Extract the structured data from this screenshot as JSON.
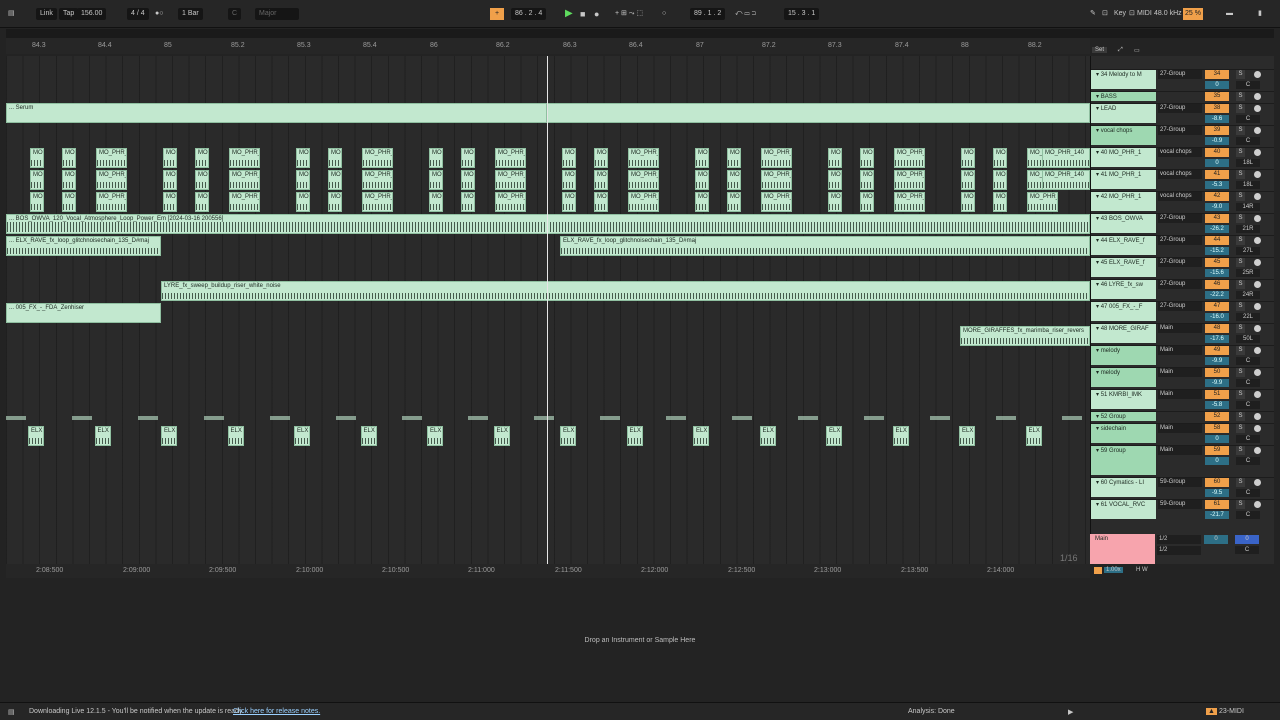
{
  "transport": {
    "link": "Link",
    "tap": "Tap",
    "tempo": "156.00",
    "signature": "4 / 4",
    "quantize": "1 Bar",
    "key": "C",
    "scale": "Major",
    "position": "86 .  2 .  4",
    "loop_start": "89 .  1 .  2",
    "loop_length": "15 .  3 .  1",
    "key_label": "Key",
    "midi_label": "MIDI",
    "sample_rate": "48.0 kHz",
    "cpu": "25 %"
  },
  "bar_ruler": [
    "84.3",
    "84.4",
    "85",
    "85.2",
    "85.3",
    "85.4",
    "86",
    "86.2",
    "86.3",
    "86.4",
    "87",
    "87.2",
    "87.3",
    "87.4",
    "88",
    "88.2"
  ],
  "time_ruler": [
    "2:08:500",
    "2:09:000",
    "2:09:500",
    "2:10:000",
    "2:10:500",
    "2:11:000",
    "2:11:500",
    "2:12:000",
    "2:12:500",
    "2:13:000",
    "2:13:500",
    "2:14:000"
  ],
  "quantize_display": "1/16",
  "set_button": "Set",
  "clips": {
    "serum": "... Serum",
    "mo_short": "MO",
    "mo_phr": "MO_PHR_",
    "mo_phr_140": "MO_PHR_140",
    "bos": "... BOS_OWVA_120_Vocal_Atmosphere_Loop_Power_Em [2024-03-16 200556]",
    "elx_rave_a": "... ELX_RAVE_fx_loop_glitchnoisechain_135_D#maj",
    "elx_rave_b": "ELX_RAVE_fx_loop_glitchnoisechain_135_D#maj",
    "lyre": "LYRE_fx_sweep_buildup_riser_white_noise",
    "fx005": "... 005_FX_-_FDA_Zenhiser",
    "giraffes": "MORE_GIRAFFES_fx_marimba_riser_revers",
    "elx": "ELX"
  },
  "tracks": [
    {
      "name": "34 Melody to M",
      "io": "27-Group",
      "num": "34",
      "vol": "0",
      "pan": "C"
    },
    {
      "name": "BASS",
      "io": "",
      "num": "35",
      "vol": "",
      "pan": ""
    },
    {
      "name": "LEAD",
      "io": "27-Group",
      "num": "38",
      "vol": "-8.6",
      "pan": "C"
    },
    {
      "name": "vocal chops",
      "io": "27-Group",
      "num": "39",
      "vol": "-0.9",
      "pan": "C"
    },
    {
      "name": "40 MO_PHR_1",
      "io": "vocal chops",
      "num": "40",
      "vol": "0",
      "pan": "18L"
    },
    {
      "name": "41 MO_PHR_1",
      "io": "vocal chops",
      "num": "41",
      "vol": "-5.3",
      "pan": "18L"
    },
    {
      "name": "42 MO_PHR_1",
      "io": "vocal chops",
      "num": "42",
      "vol": "-9.0",
      "pan": "14R"
    },
    {
      "name": "43 BOS_OWVA",
      "io": "27-Group",
      "num": "43",
      "vol": "-26.2",
      "pan": "21R"
    },
    {
      "name": "44 ELX_RAVE_f",
      "io": "27-Group",
      "num": "44",
      "vol": "-15.2",
      "pan": "27L"
    },
    {
      "name": "45 ELX_RAVE_f",
      "io": "27-Group",
      "num": "45",
      "vol": "-15.6",
      "pan": "25R"
    },
    {
      "name": "46 LYRE_fx_sw",
      "io": "27-Group",
      "num": "46",
      "vol": "-22.2",
      "pan": "24R"
    },
    {
      "name": "47 005_FX_-_F",
      "io": "27-Group",
      "num": "47",
      "vol": "-16.0",
      "pan": "22L"
    },
    {
      "name": "48 MORE_GIRAF",
      "io": "Main",
      "num": "48",
      "vol": "-17.6",
      "pan": "50L"
    },
    {
      "name": "melody",
      "io": "Main",
      "num": "49",
      "vol": "-9.9",
      "pan": "C"
    },
    {
      "name": "melody",
      "io": "Main",
      "num": "50",
      "vol": "-9.9",
      "pan": "C"
    },
    {
      "name": "51 KMRBI_IMK",
      "io": "Main",
      "num": "51",
      "vol": "-5.8",
      "pan": "C"
    },
    {
      "name": "52 Group",
      "io": "",
      "num": "52",
      "vol": "",
      "pan": ""
    },
    {
      "name": "sidechain",
      "io": "Main",
      "num": "58",
      "vol": "0",
      "pan": "C"
    },
    {
      "name": "59 Group",
      "io": "Main",
      "num": "59",
      "vol": "0",
      "pan": "C"
    },
    {
      "name": "60 Cymatics - LI",
      "io": "59-Group",
      "num": "60",
      "vol": "-9.5",
      "pan": "C"
    },
    {
      "name": "61 VOCAL_RVC",
      "io": "59-Group",
      "num": "61",
      "vol": "-21.7",
      "pan": "C"
    }
  ],
  "main_track": {
    "name": "Main",
    "io1": "1/2",
    "io2": "1/2",
    "num": "0",
    "pan": "C"
  },
  "zoom": "1.00x",
  "hw": "H W",
  "detail": {
    "drop_text": "Drop an Instrument or Sample Here"
  },
  "status": {
    "message": "Downloading Live 12.1.5 - You'll be notified when the update is ready.",
    "link": "Click here for release notes.",
    "analysis": "Analysis: Done",
    "midi": "23-MIDI"
  },
  "colors": {
    "clip": "#c2e8cf",
    "accent": "#f0a04a",
    "main_track": "#f7a4ad",
    "volume": "#2d6f86"
  }
}
